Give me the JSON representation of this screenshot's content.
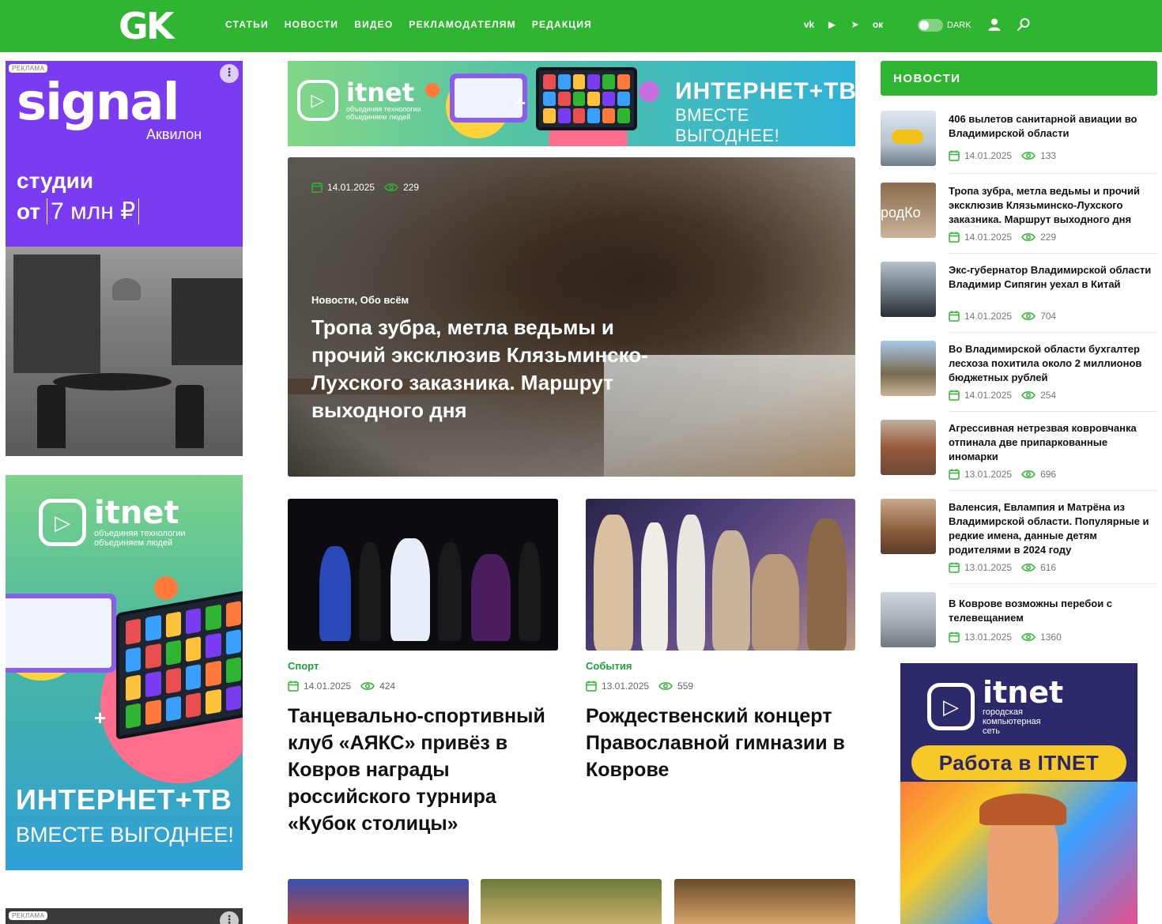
{
  "header": {
    "logo": "GK",
    "nav": [
      "СТАТЬИ",
      "НОВОСТИ",
      "ВИДЕО",
      "РЕКЛАМОДАТЕЛЯМ",
      "РЕДАКЦИЯ"
    ],
    "social": [
      {
        "name": "vk-icon",
        "glyph": "vk"
      },
      {
        "name": "youtube-icon",
        "glyph": "▶"
      },
      {
        "name": "telegram-icon",
        "glyph": "➤"
      },
      {
        "name": "odnoklassniki-icon",
        "glyph": "ок"
      }
    ],
    "dark_label": "DARK",
    "accent": "#2fb532"
  },
  "ads": {
    "tag": "РЕКЛАМА",
    "menu_glyph": "⋮",
    "signal": {
      "brand": "signal",
      "sub": "Аквилон",
      "studio": "студии",
      "price_prefix": "от",
      "price": "7 млн ₽"
    },
    "itnet": {
      "word": "itnet",
      "tag_line1": "объединяя технологии",
      "tag_line2": "объединяем людей",
      "title": "ИНТЕРНЕТ+ТВ",
      "subtitle": "ВМЕСТЕ ВЫГОДНЕЕ!",
      "plus": "+"
    },
    "itnet_right": {
      "word": "itnet",
      "tag_line1": "городская",
      "tag_line2": "компьютерная",
      "tag_line3": "сеть",
      "work": "Работа в ITNET"
    }
  },
  "hero": {
    "date": "14.01.2025",
    "views": "229",
    "categories": "Новости, Обо всём",
    "title": "Тропа зубра, метла ведьмы и прочий эксклюзив Клязьминско-Лухского заказника. Маршрут выходного дня"
  },
  "cards": [
    {
      "category": "Спорт",
      "date": "14.01.2025",
      "views": "424",
      "title": "Танцевально-спортивный клуб «АЯКС» привёз в Ковров награды российского турнира «Кубок столицы»"
    },
    {
      "category": "События",
      "date": "13.01.2025",
      "views": "559",
      "title": "Рождественский концерт Православной гимназии в Коврове"
    }
  ],
  "sidebar": {
    "heading": "НОВОСТИ",
    "items": [
      {
        "title": "406 вылетов санитарной авиации во Владимирской области",
        "date": "14.01.2025",
        "views": "133"
      },
      {
        "title": "Тропа зубра, метла ведьмы и прочий эксклюзив Клязьминско-Лухского заказника. Маршрут выходного дня",
        "date": "14.01.2025",
        "views": "229",
        "thumb_text": "родКо"
      },
      {
        "title": "Экс-губернатор Владимирской области Владимир Сипягин уехал в Китай",
        "date": "14.01.2025",
        "views": "704"
      },
      {
        "title": "Во Владимирской области бухгалтер лесхоза похитила около 2 миллионов бюджетных рублей",
        "date": "14.01.2025",
        "views": "254"
      },
      {
        "title": "Агрессивная нетрезвая ковровчанка отпинала две припаркованные иномарки",
        "date": "13.01.2025",
        "views": "696"
      },
      {
        "title": "Валенсия, Евлампия и Матрёна из Владимирской области. Популярные и редкие имена, данные детям родителями в 2024 году",
        "date": "13.01.2025",
        "views": "616"
      },
      {
        "title": "В Коврове возможны перебои с телевещанием",
        "date": "13.01.2025",
        "views": "1360"
      }
    ]
  }
}
